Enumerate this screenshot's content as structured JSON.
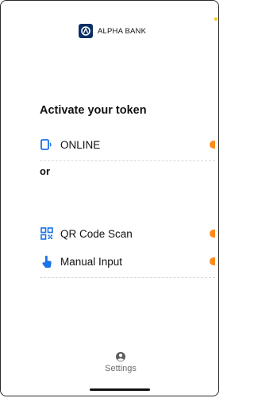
{
  "brand": {
    "name": "ALPHA BANK",
    "color": "#0b2f67"
  },
  "heading": "Activate your token",
  "options": [
    {
      "label": "ONLINE",
      "icon": "phone-signal-icon"
    },
    {
      "label": "QR Code Scan",
      "icon": "qr-code-icon"
    },
    {
      "label": "Manual Input",
      "icon": "hand-tap-icon"
    }
  ],
  "divider_text": "or",
  "footer": {
    "settings_label": "Settings",
    "icon": "user-circle-icon"
  },
  "colors": {
    "accent": "#1a73e8",
    "chevron": "#ff8c1a"
  }
}
